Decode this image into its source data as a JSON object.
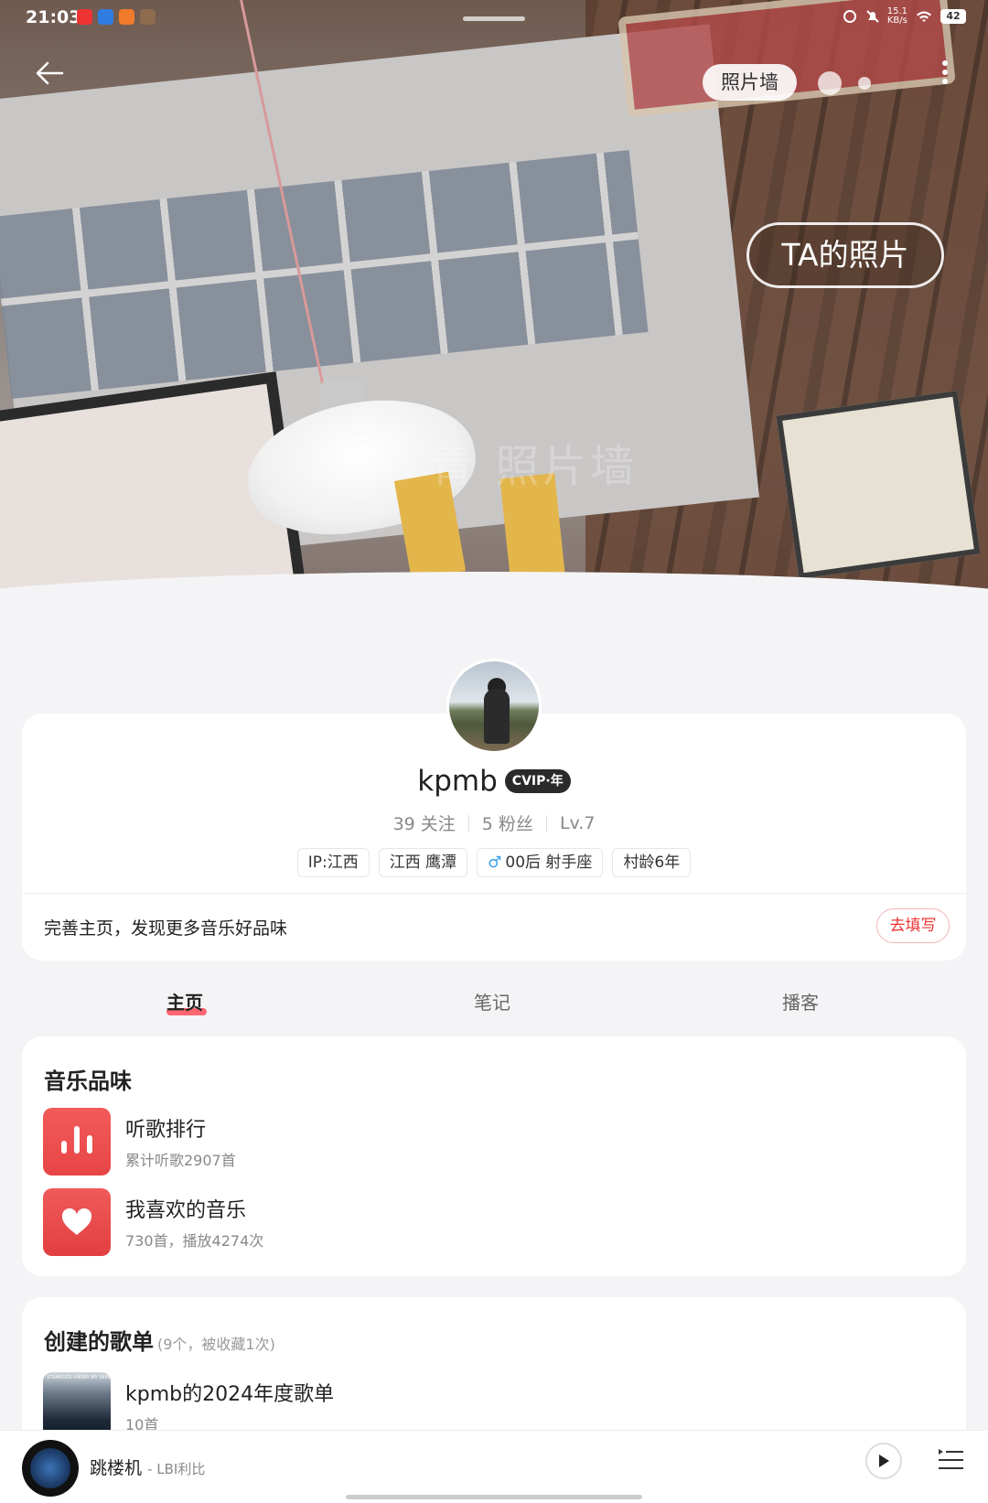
{
  "status_bar": {
    "time": "21:03",
    "network_speed_value": "15.1",
    "network_speed_unit": "KB/s",
    "battery": "42"
  },
  "header": {
    "photo_wall_label": "照片墙",
    "ta_photos_label": "TA的照片",
    "watermark": "青 照片墙"
  },
  "profile": {
    "username": "kpmb",
    "vip_badge": "CVIP·年",
    "following": "39 关注",
    "followers": "5 粉丝",
    "level": "Lv.7",
    "tags": [
      "IP:江西",
      "江西 鹰潭",
      "00后 射手座",
      "村龄6年"
    ],
    "gender_symbol": "♂",
    "prompt": "完善主页，发现更多音乐好品味",
    "fill_button": "去填写"
  },
  "tabs": [
    "主页",
    "笔记",
    "播客"
  ],
  "music_taste": {
    "title": "音乐品味",
    "items": [
      {
        "title": "听歌排行",
        "subtitle": "累计听歌2907首"
      },
      {
        "title": "我喜欢的音乐",
        "subtitle": "730首，播放4274次"
      }
    ]
  },
  "created_playlists": {
    "title": "创建的歌单",
    "meta": "(9个，被收藏1次)",
    "items": [
      {
        "title": "kpmb的2024年度歌单",
        "subtitle": "10首",
        "cover_text": "STRANGER UNDER MY SKIN"
      }
    ]
  },
  "player": {
    "song": "跳楼机",
    "artist": "- LBI利比"
  },
  "colors": {
    "accent_red": "#ff4d5a",
    "fill_button_red": "#e33333",
    "male_blue": "#3aa0e8"
  },
  "icons": {
    "back": "arrow-left-icon",
    "more": "more-vertical-icon",
    "play": "play-icon",
    "queue": "playlist-queue-icon",
    "like": "heart-icon",
    "rank": "bar-chart-icon"
  }
}
